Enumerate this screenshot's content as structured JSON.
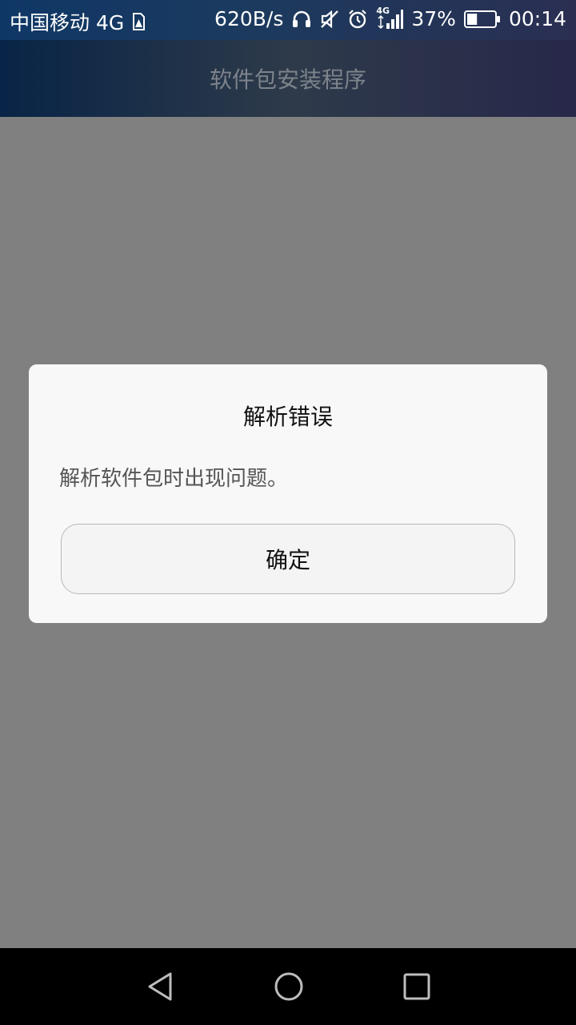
{
  "status_bar": {
    "carrier": "中国移动 4G",
    "net_speed": "620B/s",
    "signal_type": "4G",
    "battery_percent": "37%",
    "battery_level": 0.37,
    "time": "00:14",
    "icons": [
      "sim-alert-icon",
      "headphones-icon",
      "vibrate-muted-icon",
      "alarm-icon",
      "signal-icon",
      "battery-icon"
    ]
  },
  "app_bar": {
    "title": "软件包安装程序"
  },
  "dialog": {
    "title": "解析错误",
    "message": "解析软件包时出现问题。",
    "ok_label": "确定"
  },
  "nav_bar": {
    "icons": [
      "back-icon",
      "home-icon",
      "recents-icon"
    ]
  },
  "colors": {
    "status_bar_start": "#0f3766",
    "app_bar_start": "#082446",
    "scrim": "#808080",
    "dialog_bg": "#f8f8f8",
    "nav_bar": "#000000"
  }
}
